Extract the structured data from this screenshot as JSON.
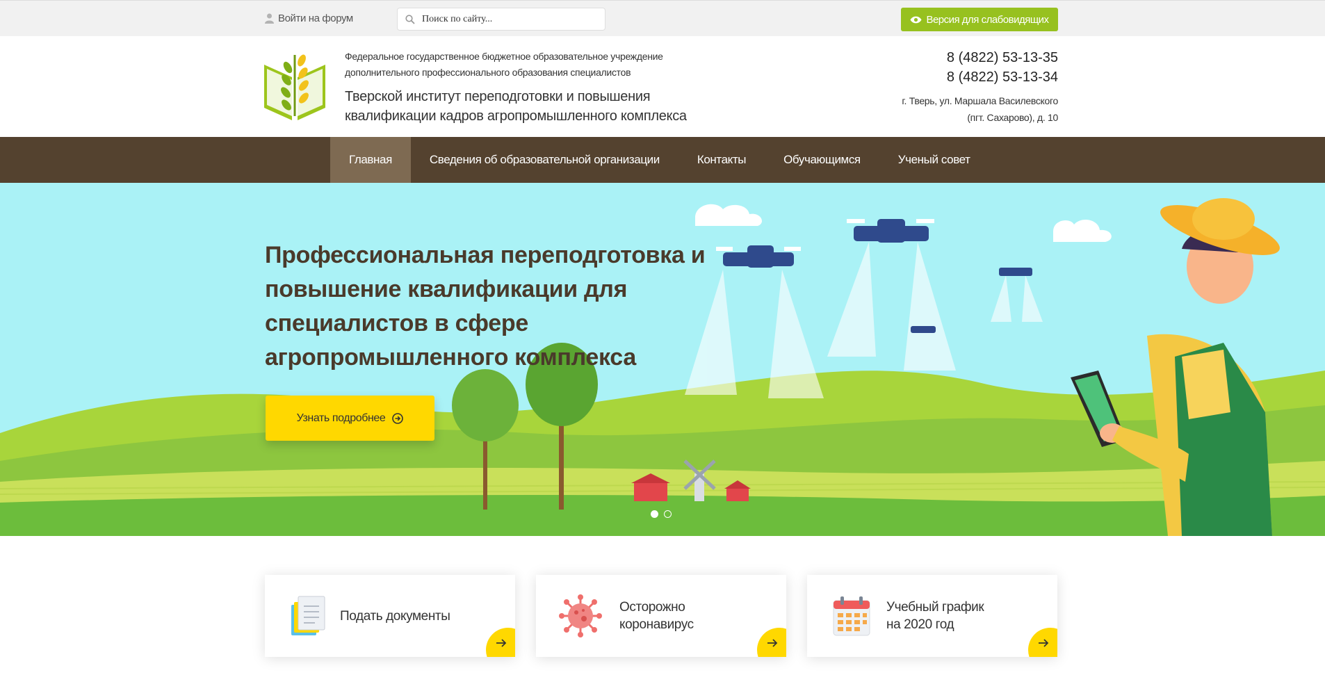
{
  "topbar": {
    "forum_label": "Войти на форум",
    "search_placeholder": "Поиск по сайту...",
    "vision_label": "Версия для слабовидящих"
  },
  "header": {
    "org_subtitle": "Федеральное государственное бюджетное образовательное учреждение дополнительного профессионального образования специалистов",
    "org_name": "Тверской институт переподготовки и повышения квалификации кадров агропромышленного комплекса",
    "phones": [
      "8 (4822) 53-13-35",
      "8 (4822) 53-13-34"
    ],
    "address_line1": "г. Тверь, ул. Маршала Василевского",
    "address_line2": "(пгт. Сахарово), д. 10"
  },
  "nav": {
    "items": [
      {
        "label": "Главная",
        "active": true
      },
      {
        "label": "Сведения об образовательной организации",
        "active": false
      },
      {
        "label": "Контакты",
        "active": false
      },
      {
        "label": "Обучающимся",
        "active": false
      },
      {
        "label": "Ученый совет",
        "active": false
      }
    ]
  },
  "hero": {
    "title": "Профессиональная переподготовка и повышение квалификации для специалистов в сфере агропромышленного комплекса",
    "button_label": "Узнать подробнее",
    "slides_total": 2,
    "active_slide": 1
  },
  "cards": [
    {
      "label_line1": "Подать документы",
      "label_line2": "",
      "icon": "documents-icon"
    },
    {
      "label_line1": "Осторожно",
      "label_line2": "коронавирус",
      "icon": "virus-icon"
    },
    {
      "label_line1": "Учебный график",
      "label_line2": "на 2020 год",
      "icon": "calendar-icon"
    }
  ],
  "colors": {
    "nav_bg": "#54422f",
    "nav_active": "#7e6a52",
    "accent_green": "#97c11f",
    "accent_yellow": "#ffd800",
    "hero_sky": "#aaf2f6",
    "title_brown": "#4a3a2b"
  }
}
